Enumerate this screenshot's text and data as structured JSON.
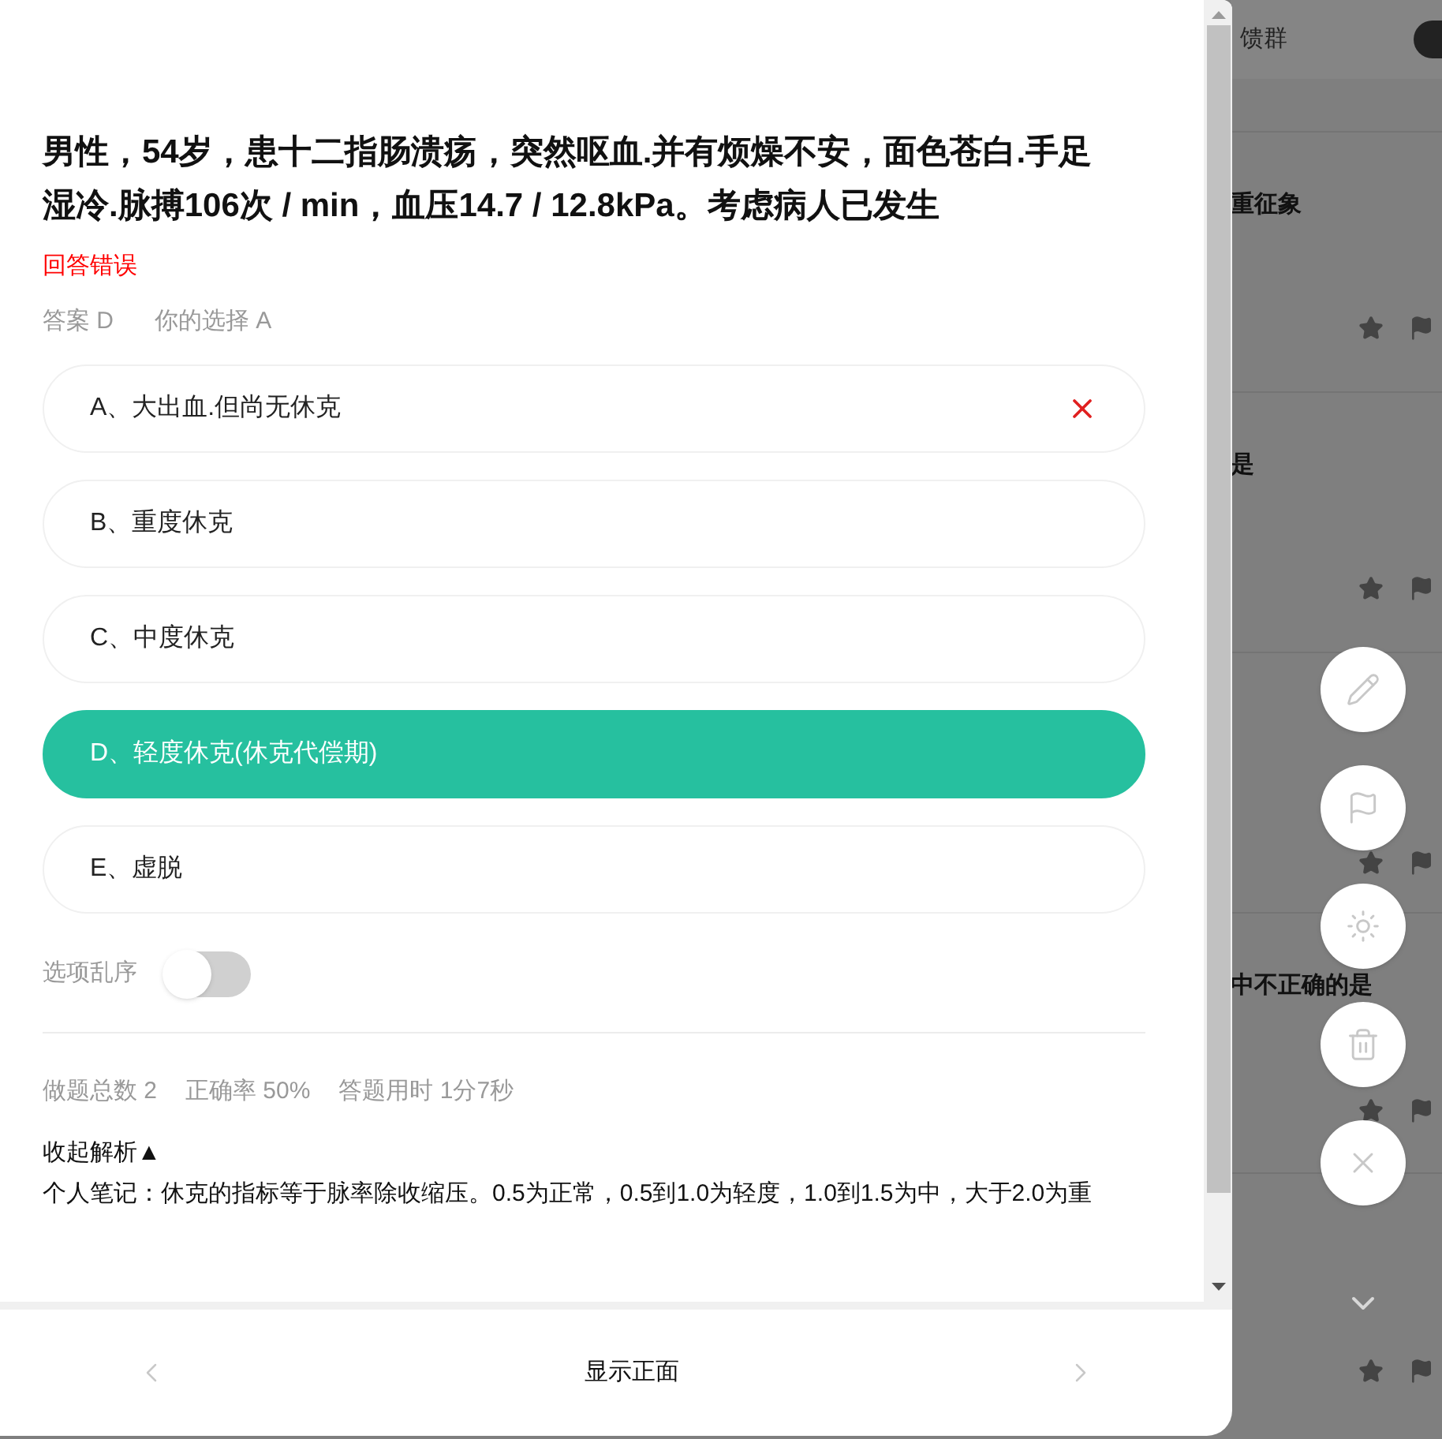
{
  "question": {
    "text": "男性，54岁，患十二指肠溃疡，突然呕血.并有烦燥不安，面色苍白.手足湿冷.脉搏106次 / min，血压14.7 / 12.8kPa。考虑病人已发生",
    "result": "回答错误",
    "answer": "答案 D",
    "your_choice": "你的选择 A"
  },
  "options": [
    {
      "label": "A、大出血.但尚无休克",
      "kind": "wrong"
    },
    {
      "label": "B、重度休克",
      "kind": "normal"
    },
    {
      "label": "C、中度休克",
      "kind": "normal"
    },
    {
      "label": "D、轻度休克(休克代偿期)",
      "kind": "correct"
    },
    {
      "label": "E、虚脱",
      "kind": "normal"
    }
  ],
  "shuffle": {
    "label": "选项乱序",
    "on": false
  },
  "stats": [
    "做题总数 2",
    "正确率 50%",
    "答题用时 1分7秒"
  ],
  "analysis": {
    "toggle": "收起解析▲",
    "note": "个人笔记：休克的指标等于脉率除收缩压。0.5为正常，0.5到1.0为轻度，1.0到1.5为中，大于2.0为重"
  },
  "footer": {
    "center": "显示正面"
  },
  "background": {
    "header": "馈群",
    "items": [
      {
        "title": "重征象",
        "starred": false
      },
      {
        "title": "是",
        "starred": false
      },
      {
        "starred": false
      },
      {
        "title": "中不正确的是",
        "starred": false
      },
      {
        "starred": false
      }
    ]
  }
}
